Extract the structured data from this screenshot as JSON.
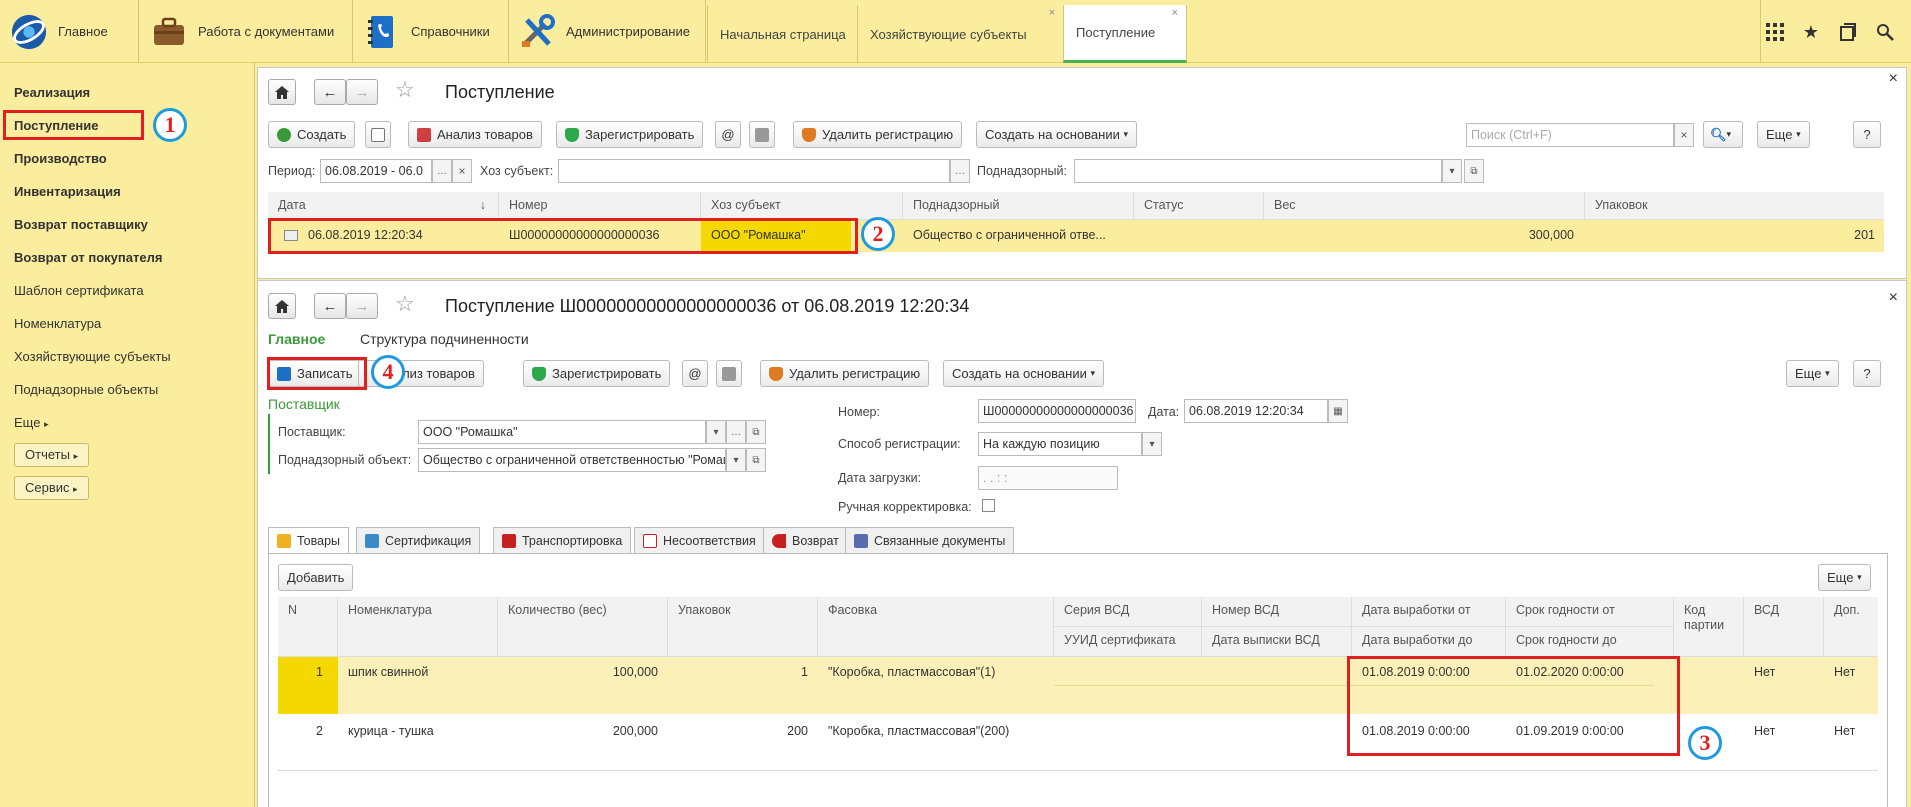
{
  "topbar": {
    "sections": [
      {
        "label": "Главное",
        "icon": "app-logo-icon"
      },
      {
        "label": "Работа с документами",
        "icon": "briefcase-icon"
      },
      {
        "label": "Справочники",
        "icon": "phonebook-icon"
      },
      {
        "label": "Администрирование",
        "icon": "tools-icon"
      }
    ],
    "window_tabs": [
      {
        "label": "Начальная страница",
        "close": ""
      },
      {
        "label": "Хозяйствующие субъекты",
        "close": "×"
      },
      {
        "label": "Поступление",
        "close": "×"
      }
    ]
  },
  "sidebar": {
    "items": [
      "Реализация",
      "Поступление",
      "Производство",
      "Инвентаризация",
      "Возврат поставщику",
      "Возврат от покупателя",
      "Шаблон сертификата",
      "Номенклатура",
      "Хозяйствующие субъекты",
      "Поднадзорные объекты",
      "Еще"
    ],
    "buttons": [
      "Отчеты",
      "Сервис"
    ]
  },
  "list_form": {
    "title": "Поступление",
    "close": "×",
    "toolbar": {
      "create": "Создать",
      "analysis": "Анализ товаров",
      "register": "Зарегистрировать",
      "at": "@",
      "delete_reg": "Удалить регистрацию",
      "create_based": "Создать на основании",
      "search_placeholder": "Поиск (Ctrl+F)",
      "more": "Еще",
      "help": "?"
    },
    "filters": {
      "period_label": "Период:",
      "period_value": "06.08.2019 - 06.0",
      "subject_label": "Хоз субъект:",
      "supervised_label": "Поднадзорный:"
    },
    "columns": [
      "Дата",
      "Номер",
      "Хоз субъект",
      "Поднадзорный",
      "Статус",
      "Вес",
      "Упаковок"
    ],
    "sort_arrow": "↓",
    "row": {
      "date": "06.08.2019 12:20:34",
      "number": "Ш00000000000000000036",
      "subject": "ООО \"Ромашка\"",
      "supervised": "Общество с ограниченной отве...",
      "status": "",
      "weight": "300,000",
      "packages": "201"
    }
  },
  "doc_form": {
    "title": "Поступление Ш00000000000000000036 от 06.08.2019 12:20:34",
    "close": "×",
    "nav": {
      "main": "Главное",
      "structure": "Структура подчиненности"
    },
    "toolbar": {
      "save": "Записать",
      "analysis": "Анализ товаров",
      "register": "Зарегистрировать",
      "at": "@",
      "delete_reg": "Удалить регистрацию",
      "create_based": "Создать на основании",
      "more": "Еще",
      "help": "?"
    },
    "supplier_group": "Поставщик",
    "supplier_label": "Поставщик:",
    "supplier_value": "ООО \"Ромашка\"",
    "object_label": "Поднадзорный объект:",
    "object_value": "Общество с ограниченной ответственностью \"Ромашка\"",
    "number_label": "Номер:",
    "number_value": "Ш00000000000000000036",
    "date_label": "Дата:",
    "date_value": "06.08.2019 12:20:34",
    "reg_label": "Способ регистрации:",
    "reg_value": "На каждую позицию",
    "load_date_label": "Дата загрузки:",
    "load_date_value": " .  .        :  :",
    "manual_label": "Ручная корректировка:",
    "tabs": [
      "Товары",
      "Сертификация",
      "Транспортировка",
      "Несоответствия",
      "Возврат",
      "Связанные документы"
    ],
    "add_button": "Добавить",
    "more": "Еще",
    "columns_top": [
      "N",
      "Номенклатура",
      "Количество (вес)",
      "Упаковок",
      "Фасовка",
      "Серия ВСД",
      "Номер ВСД",
      "Дата выработки от",
      "Срок годности от",
      "Код партии",
      "ВСД",
      "Доп."
    ],
    "columns_bottom": [
      "УУИД сертификата",
      "Дата выписки ВСД",
      "Дата выработки до",
      "Срок годности до"
    ],
    "rows": [
      {
        "n": "1",
        "name": "шпик свинной",
        "qty": "100,000",
        "pkg": "1",
        "packing": "\"Коробка, пластмассовая\"(1)",
        "prod_from": "01.08.2019 0:00:00",
        "exp_from": "01.02.2020 0:00:00",
        "vsd": "Нет",
        "extra": "Нет"
      },
      {
        "n": "2",
        "name": "курица - тушка",
        "qty": "200,000",
        "pkg": "200",
        "packing": "\"Коробка, пластмассовая\"(200)",
        "prod_from": "01.08.2019 0:00:00",
        "exp_from": "01.09.2019 0:00:00",
        "vsd": "Нет",
        "extra": "Нет"
      }
    ]
  },
  "annotations": [
    "1",
    "2",
    "3",
    "4"
  ],
  "colors": {
    "highlight": "#fbed9e",
    "annotation_red": "#e02020",
    "annotation_blue": "#1e9be0",
    "green": "#4caf50"
  }
}
